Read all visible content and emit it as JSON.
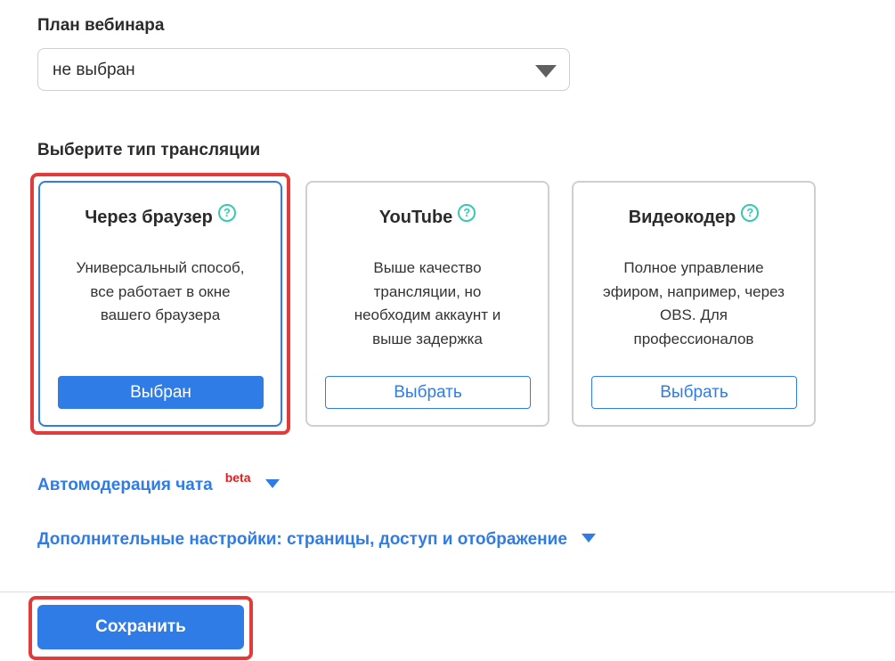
{
  "plan": {
    "label": "План вебинара",
    "selected_value": "не выбран"
  },
  "broadcast": {
    "label": "Выберите тип трансляции",
    "cards": [
      {
        "title": "Через браузер",
        "description": "Универсальный способ, все работает в окне вашего браузера",
        "button_label": "Выбран",
        "selected": true
      },
      {
        "title": "YouTube",
        "description": "Выше качество трансляции, но необходим аккаунт и выше задержка",
        "button_label": "Выбрать",
        "selected": false
      },
      {
        "title": "Видеокодер",
        "description": "Полное управление эфиром, например, через OBS. Для профессионалов",
        "button_label": "Выбрать",
        "selected": false
      }
    ],
    "help_icon_glyph": "?"
  },
  "chat_moderation": {
    "label": "Автомодерация чата",
    "badge": "beta"
  },
  "extra_settings": {
    "label": "Дополнительные настройки: страницы, доступ и отображение"
  },
  "save_label": "Сохранить",
  "colors": {
    "accent": "#2f7ce6",
    "help": "#36c9b0",
    "highlight": "#e23b3b",
    "badge": "#e02020"
  },
  "icons": {
    "dropdown": "triangle-down-icon",
    "help": "question-circle-icon",
    "expand": "caret-down-icon"
  }
}
